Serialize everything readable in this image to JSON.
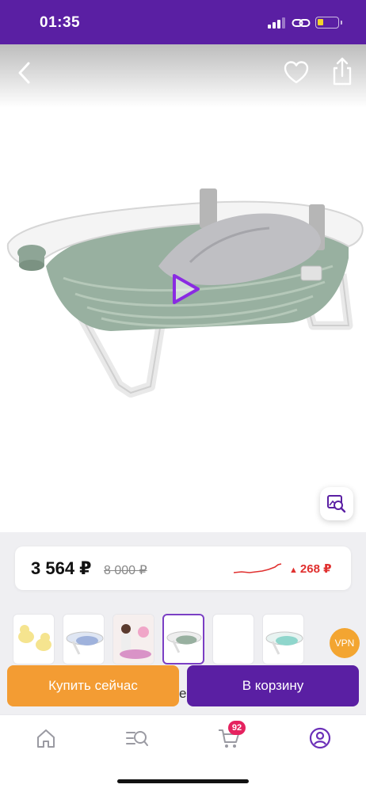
{
  "status_bar": {
    "time": "01:35",
    "signal_icon": "cellular-signal-icon",
    "link_icon": "link-icon",
    "battery_icon": "battery-low-icon",
    "battery_color": "#f3d32a"
  },
  "header": {
    "back_icon": "chevron-left-icon",
    "favorite_icon": "heart-outline-icon",
    "share_icon": "share-icon"
  },
  "product": {
    "image_description_icon": "baby-bath-tub-image",
    "play_icon": "play-icon",
    "visual_search_icon": "image-search-icon"
  },
  "price": {
    "current": "3 564 ₽",
    "old": "8 000 ₽",
    "change": "268 ₽",
    "change_arrow": "▲",
    "change_color": "#e0302f",
    "trend_icon": "price-trend-graph"
  },
  "thumbnails": [
    {
      "name": "thumb-ducks",
      "active": false
    },
    {
      "name": "thumb-tub-blue",
      "active": false
    },
    {
      "name": "thumb-woman-baby",
      "active": false
    },
    {
      "name": "thumb-tub-green",
      "active": true
    },
    {
      "name": "thumb-blank",
      "active": false
    },
    {
      "name": "thumb-tub-mint",
      "active": false
    }
  ],
  "vpn_badge": "VPN",
  "actions": {
    "buy_now": "Купить сейчас",
    "hidden_fragment": "е",
    "add_to_cart": "В корзину",
    "buy_color": "#f39c33",
    "cart_color": "#5a1fa3"
  },
  "bottom_nav": {
    "items": [
      {
        "icon": "home-icon"
      },
      {
        "icon": "catalog-search-icon"
      },
      {
        "icon": "cart-icon"
      },
      {
        "icon": "profile-icon"
      }
    ],
    "cart_count": "92"
  },
  "accent_color": "#5a1fa3"
}
